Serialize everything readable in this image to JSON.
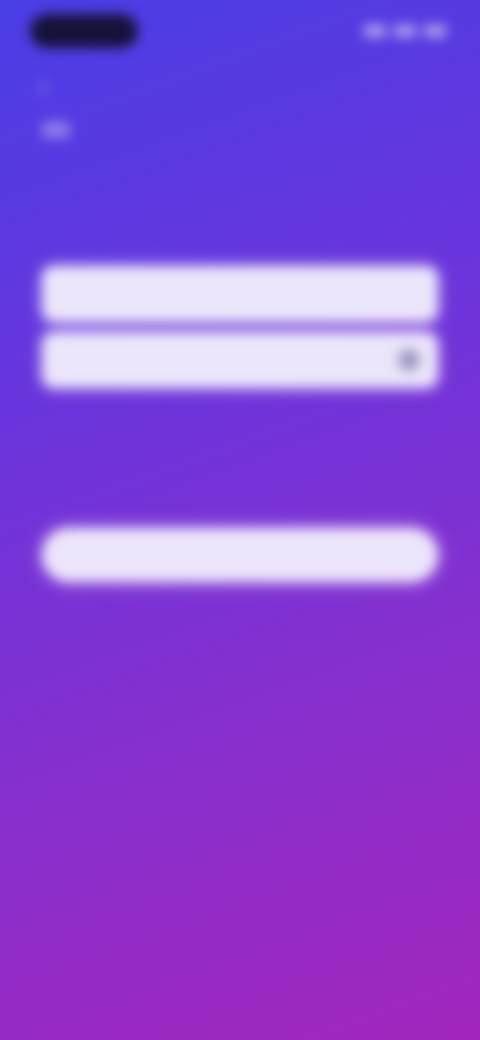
{
  "status_bar": {
    "time": "",
    "pill_color": "#16123a"
  },
  "header": {
    "back_icon": "chevron-left-icon",
    "logo_icon": "logo-icon",
    "title": "",
    "subtitle": ""
  },
  "form": {
    "email_placeholder": "",
    "email_value": "",
    "password_placeholder": "",
    "password_value": "",
    "password_toggle_icon": "eye-icon",
    "links": [
      "",
      ""
    ],
    "submit_label": ""
  },
  "colors": {
    "gradient_start": "#4a3fe6",
    "gradient_end": "#a226bd",
    "field_background": "#ece6fb",
    "button_background": "#ede5fb"
  }
}
